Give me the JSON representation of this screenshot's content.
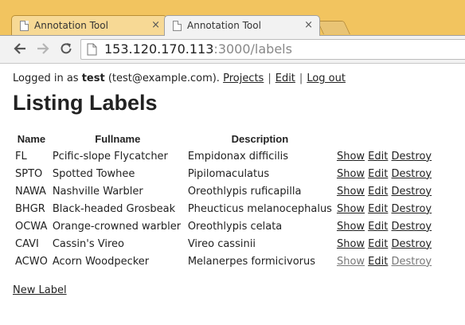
{
  "browser": {
    "tabs": [
      {
        "title": "Annotation Tool",
        "close": "×",
        "active": false
      },
      {
        "title": "Annotation Tool",
        "close": "×",
        "active": true
      }
    ],
    "url": {
      "host": "153.120.170.113",
      "path": ":3000/labels"
    }
  },
  "header": {
    "prefix": "Logged in as",
    "username": "test",
    "email": "(test@example.com).",
    "links": [
      "Projects",
      "Edit",
      "Log out"
    ],
    "separator": "|"
  },
  "title": "Listing Labels",
  "table": {
    "columns": [
      "Name",
      "Fullname",
      "Description"
    ],
    "rows": [
      {
        "name": "FL",
        "fullname": "Pcific-slope Flycatcher",
        "description": "Empidonax difficilis"
      },
      {
        "name": "SPTO",
        "fullname": "Spotted Towhee",
        "description": "Pipilomaculatus"
      },
      {
        "name": "NAWA",
        "fullname": "Nashville Warbler",
        "description": "Oreothlypis ruficapilla"
      },
      {
        "name": "BHGR",
        "fullname": "Black-headed Grosbeak",
        "description": "Pheucticus melanocephalus"
      },
      {
        "name": "OCWA",
        "fullname": "Orange-crowned warbler",
        "description": "Oreothlypis celata"
      },
      {
        "name": "CAVI",
        "fullname": "Cassin's Vireo",
        "description": "Vireo cassinii"
      },
      {
        "name": "ACWO",
        "fullname": "Acorn Woodpecker",
        "description": "Melanerpes formicivorus"
      }
    ],
    "actions": [
      "Show",
      "Edit",
      "Destroy"
    ]
  },
  "new_label": "New Label",
  "icons": {
    "back": "back-arrow-icon",
    "forward": "forward-arrow-icon",
    "reload": "reload-icon",
    "page": "page-icon",
    "tab_favicon": "document-icon"
  },
  "colors": {
    "chrome": "#f2c45f",
    "toolbar": "#f2f2f2",
    "text": "#222222"
  }
}
